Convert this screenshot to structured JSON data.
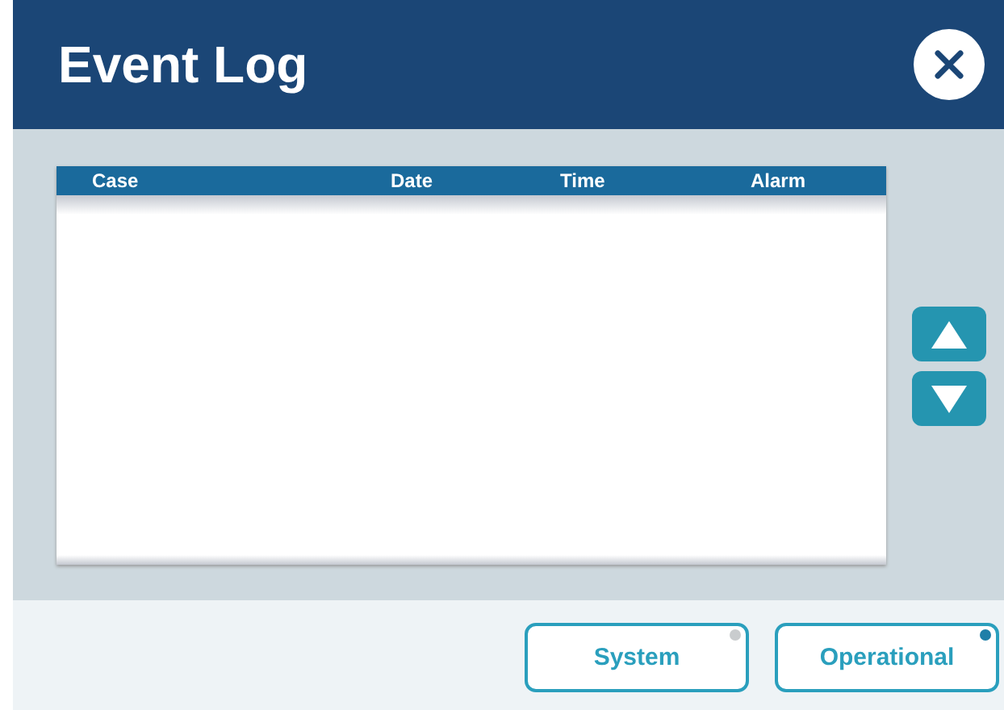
{
  "window": {
    "title": "Event Log"
  },
  "table": {
    "columns": [
      "Case",
      "Date",
      "Time",
      "Alarm"
    ]
  },
  "filters": [
    {
      "label": "System",
      "selected": false
    },
    {
      "label": "Operational",
      "selected": true
    }
  ]
}
